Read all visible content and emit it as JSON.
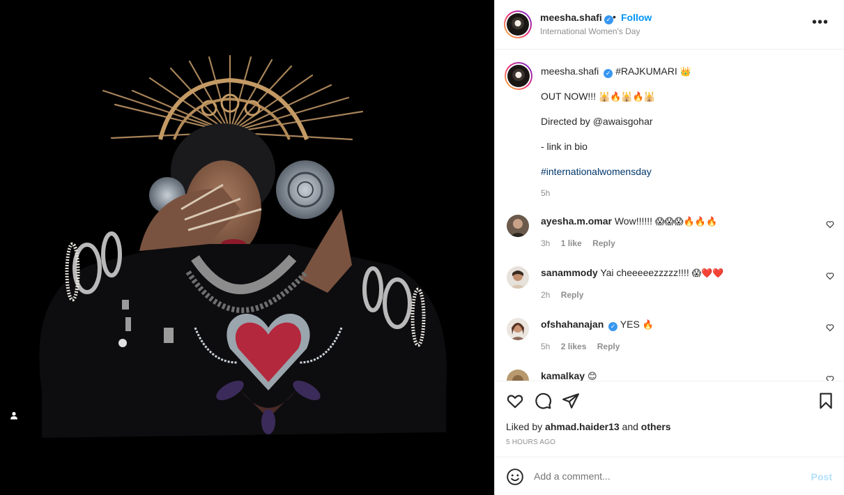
{
  "post": {
    "username": "meesha.shafi",
    "verified_mark": "✓",
    "follow_separator": "•",
    "follow_label": "Follow",
    "location": "International Women's Day",
    "more_icon": "•••"
  },
  "caption": {
    "username": "meesha.shafi",
    "hashtag_title": "#RAJKUMARI",
    "crown_emoji": "👑",
    "line1": "OUT NOW!!!",
    "line1_emojis": "🕌🔥🕌🔥🕌",
    "directed_prefix": "Directed by",
    "directed_handle": "@awaisgohar",
    "link_line": "- link in bio",
    "hashtag": "#internationalwomensday",
    "time": "5h"
  },
  "comments": [
    {
      "username": "ayesha.m.omar",
      "text": "Wow!!!!!!",
      "emojis": "😱😱😱🔥🔥🔥",
      "time": "3h",
      "likes": "1 like",
      "reply": "Reply"
    },
    {
      "username": "sanammody",
      "text": "Yai cheeeeezzzzz!!!!",
      "emojis": "😱❤️❤️",
      "time": "2h",
      "likes": "",
      "reply": "Reply"
    },
    {
      "username": "ofshahanajan",
      "text": "YES",
      "emojis": "🔥",
      "time": "5h",
      "likes": "2 likes",
      "reply": "Reply",
      "verified": true
    },
    {
      "username": "kamalkay",
      "text": "",
      "emojis": "😊",
      "time": "",
      "likes": "",
      "reply": ""
    }
  ],
  "actions": {
    "liked_prefix": "Liked by",
    "liked_user": "ahmad.haider13",
    "liked_and": "and",
    "liked_others": "others",
    "posted_ago": "5 HOURS AGO"
  },
  "add_comment": {
    "placeholder": "Add a comment...",
    "post_label": "Post"
  },
  "icons": [
    "like-heart-icon",
    "comment-icon",
    "share-icon",
    "save-bookmark-icon",
    "emoji-icon",
    "more-options-icon",
    "user-tag-icon"
  ],
  "colors": {
    "accent": "#0095f6",
    "verified": "#3897f0",
    "hashtag": "#00376b",
    "muted": "#8e8e8e",
    "post_disabled": "#b2dffc"
  }
}
